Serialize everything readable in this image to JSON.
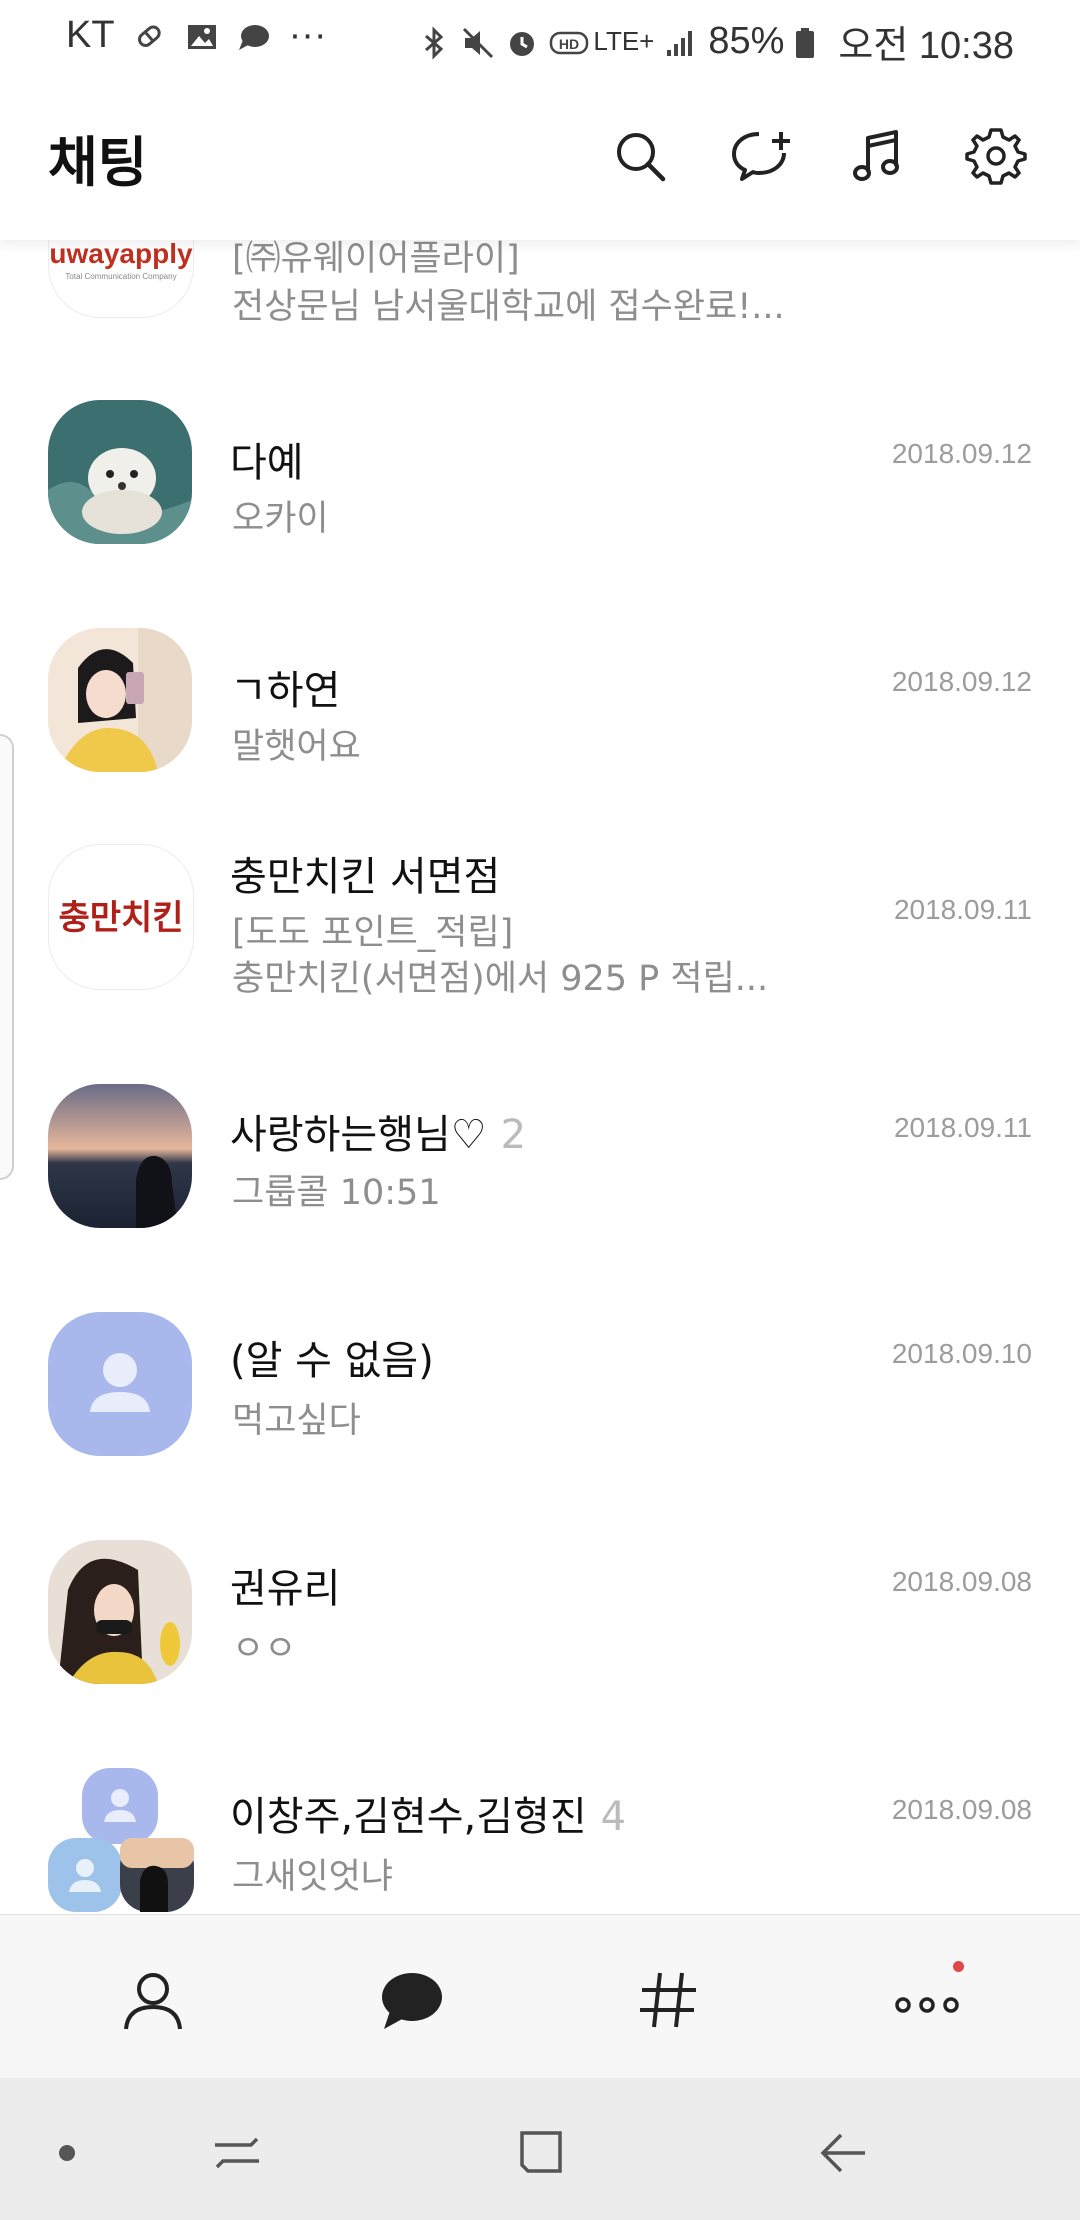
{
  "status": {
    "carrier": "KT",
    "network": "LTE+",
    "battery": "85%",
    "time": "오전 10:38",
    "icons": [
      "pill-icon",
      "image-icon",
      "chat-bubble-icon",
      "more-dots-icon",
      "bluetooth-icon",
      "mute-icon",
      "alarm-icon",
      "hd-icon",
      "lte-icon",
      "signal-icon",
      "battery-icon"
    ]
  },
  "header": {
    "title": "채팅",
    "icons": [
      "search-icon",
      "new-chat-icon",
      "music-icon",
      "settings-icon"
    ]
  },
  "chats": [
    {
      "name": "㈜유웨이어플라이",
      "msg_line1": "[㈜유웨이어플라이]",
      "msg_line2": "전상문님 남서울대학교에 접수완료!...",
      "date": "",
      "count": "",
      "avatar": "uwayapply",
      "logo_text": "uwayapply",
      "logo_sub": "Total Communication Company"
    },
    {
      "name": "다예",
      "msg": "오카이",
      "date": "2018.09.12",
      "count": "",
      "avatar": "dog-photo"
    },
    {
      "name": "ㄱ하연",
      "msg": "말햇어요",
      "date": "2018.09.12",
      "count": "",
      "avatar": "girl-selfie"
    },
    {
      "name": "충만치킨 서면점",
      "msg_line1": "[도도 포인트_적립]",
      "msg_line2": "충만치킨(서면점)에서 925 P 적립...",
      "date": "2018.09.11",
      "count": "",
      "avatar": "chungman-logo",
      "logo_text": "충만치킨"
    },
    {
      "name": "사랑하는행님♡",
      "msg": "그룹콜 10:51",
      "date": "2018.09.11",
      "count": "2",
      "avatar": "sunset-photo"
    },
    {
      "name": "(알 수 없음)",
      "msg": "먹고싶다",
      "date": "2018.09.10",
      "count": "",
      "avatar": "default-person"
    },
    {
      "name": "권유리",
      "msg": "ㅇㅇ",
      "date": "2018.09.08",
      "count": "",
      "avatar": "girl-photo"
    },
    {
      "name": "이창주,김현수,김형진",
      "msg": "그새잇엇냐",
      "date": "2018.09.08",
      "count": "4",
      "avatar": "group-avatar"
    }
  ],
  "tabs": [
    {
      "name": "friends",
      "icon": "person-icon"
    },
    {
      "name": "chats",
      "icon": "chat-bubble-icon",
      "active": true
    },
    {
      "name": "hashtag",
      "icon": "hashtag-icon"
    },
    {
      "name": "more",
      "icon": "more-dots-icon",
      "badge": true
    }
  ],
  "nav": [
    "dot-icon",
    "recent-apps-icon",
    "home-icon",
    "back-icon"
  ],
  "colors": {
    "accent": "#222222",
    "unknown_avatar": "#a8b8ec",
    "badge": "#e04848"
  }
}
